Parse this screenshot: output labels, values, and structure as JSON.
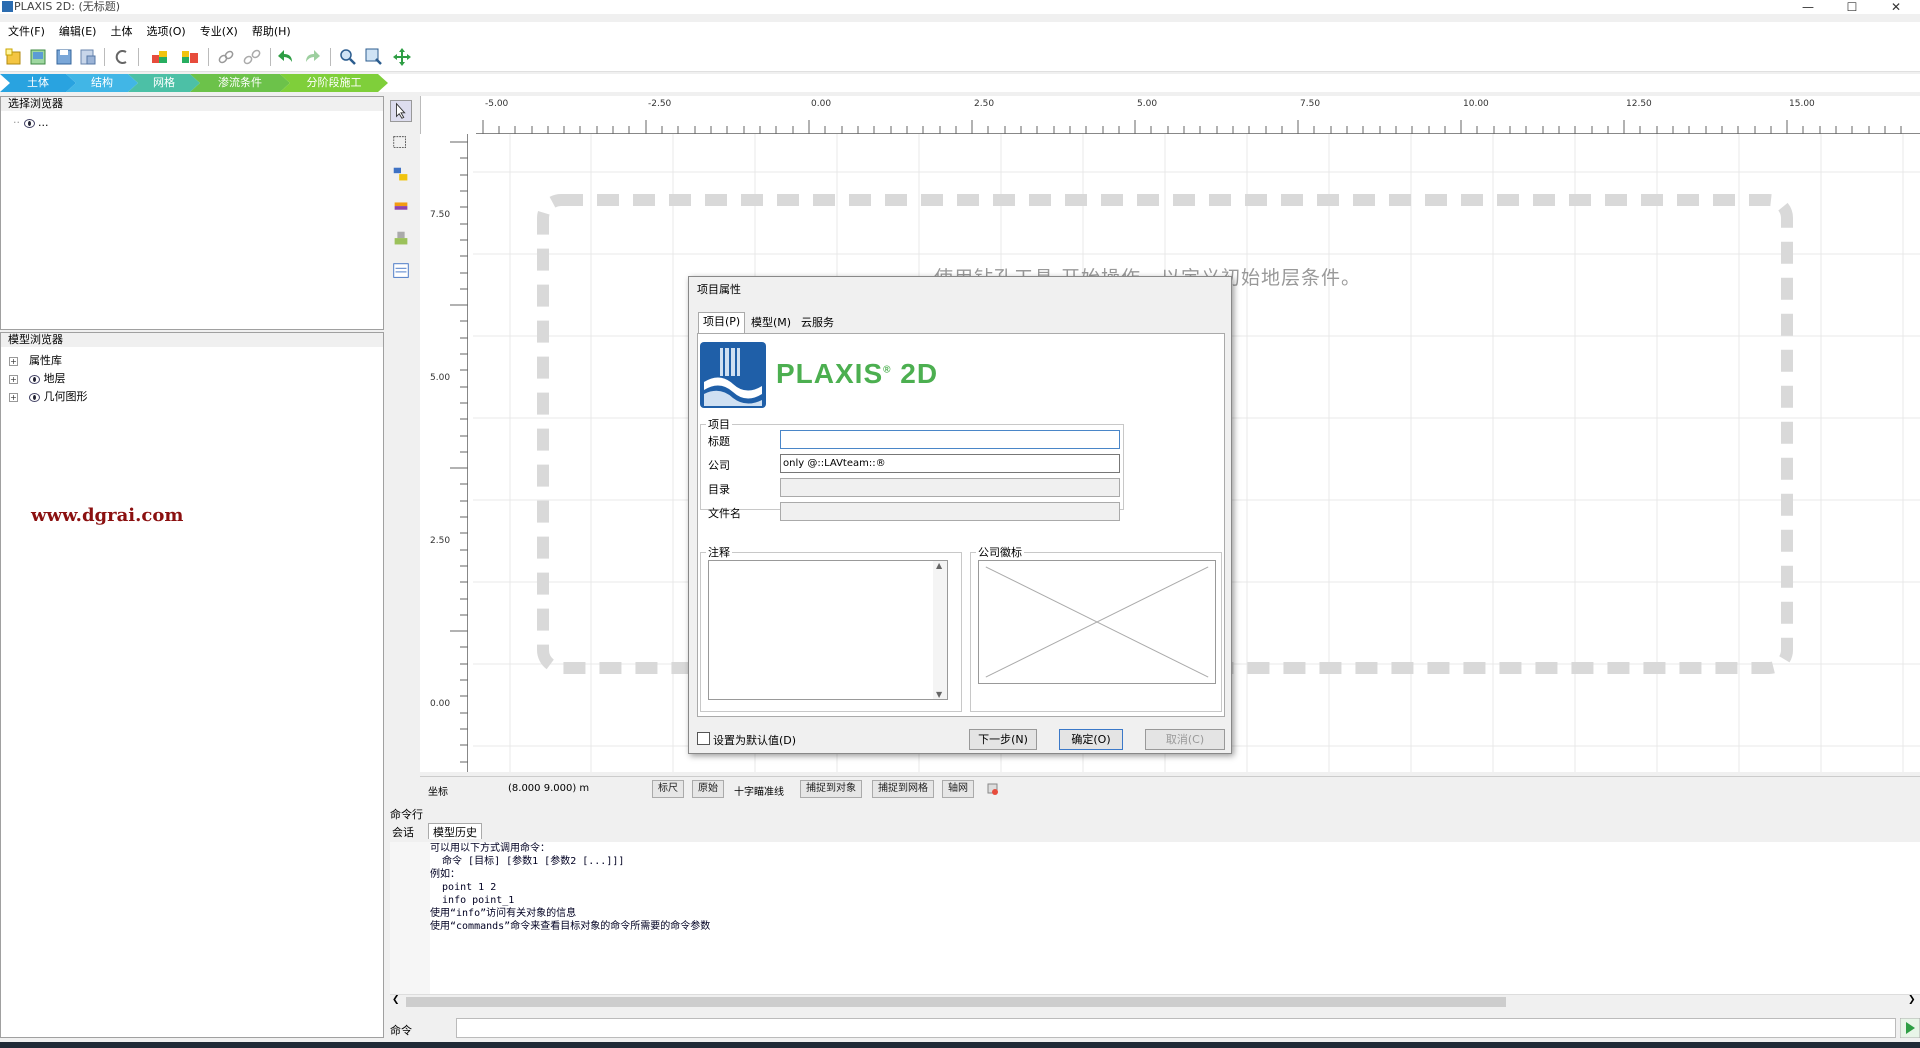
{
  "window": {
    "title": "PLAXIS 2D: (无标题)"
  },
  "menu": [
    "文件(F)",
    "编辑(E)",
    "土体",
    "选项(O)",
    "专业(X)",
    "帮助(H)"
  ],
  "modes": [
    {
      "label": "土体",
      "color": "#29a3e0"
    },
    {
      "label": "结构",
      "color": "#41b6e6"
    },
    {
      "label": "网格",
      "color": "#4cc0a6"
    },
    {
      "label": "渗流条件",
      "color": "#6cc24a"
    },
    {
      "label": "分阶段施工",
      "color": "#7fcf3a"
    }
  ],
  "selection_browser": {
    "title": "选择浏览器",
    "root": "..."
  },
  "model_browser": {
    "title": "模型浏览器",
    "items": [
      "属性库",
      "地层",
      "几何图形"
    ]
  },
  "watermark": "www.dgrai.com",
  "rulers": {
    "h": [
      "-5.00",
      "-2.50",
      "0.00",
      "2.50",
      "5.00",
      "7.50",
      "10.00",
      "12.50",
      "15.00"
    ],
    "v": [
      "7.50",
      "5.00",
      "2.50",
      "0.00"
    ]
  },
  "canvas_hint": "使用钻孔工具 开始操作，以定义初始地层条件。",
  "status": {
    "coord_label": "坐标",
    "coord_value": "(8.000 9.000) m",
    "buttons": [
      "标尺",
      "原始",
      "捕捉到对象",
      "捕捉到网格",
      "轴网"
    ],
    "crosshair": "十字瞄准线"
  },
  "command": {
    "title": "命令行",
    "tabs": [
      "会话",
      "模型历史"
    ],
    "lines": [
      "可以用以下方式调用命令：",
      "  命令 [目标] [参数1 [参数2 [...]]]",
      "例如：",
      "  point 1 2",
      "  info point_1",
      "使用“info”访问有关对象的信息",
      "使用“commands”命令来查看目标对象的命令所需要的命令参数"
    ],
    "input_label": "命令"
  },
  "dialog": {
    "title": "项目属性",
    "tabs": [
      "项目(P)",
      "模型(M)",
      "云服务"
    ],
    "brand": "PLAXIS",
    "brand_sup": "®",
    "brand_suffix": " 2D",
    "group_project": "项目",
    "fields": [
      {
        "label": "标题",
        "value": "",
        "disabled": false
      },
      {
        "label": "公司",
        "value": "only @::LAVteam::®",
        "disabled": false
      },
      {
        "label": "目录",
        "value": "",
        "disabled": true
      },
      {
        "label": "文件名",
        "value": "",
        "disabled": true
      }
    ],
    "group_notes": "注释",
    "group_logo": "公司徽标",
    "default_checkbox": "设置为默认值(D)",
    "buttons": {
      "next": "下一步(N)",
      "ok": "确定(O)",
      "cancel": "取消(C)"
    }
  }
}
